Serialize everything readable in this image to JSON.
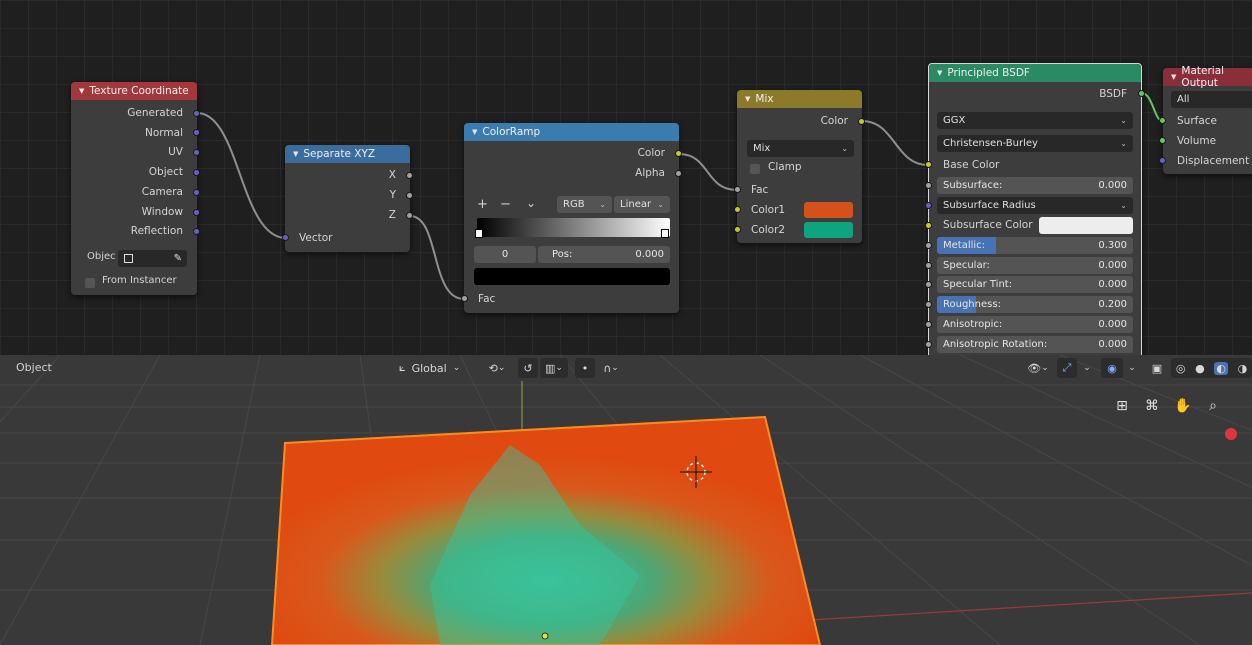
{
  "nodes": {
    "texture_coordinate": {
      "title": "Texture Coordinate",
      "outputs": [
        "Generated",
        "Normal",
        "UV",
        "Object",
        "Camera",
        "Window",
        "Reflection"
      ],
      "object_label": "Objec",
      "from_instancer_label": "From Instancer"
    },
    "separate_xyz": {
      "title": "Separate XYZ",
      "outputs": [
        "X",
        "Y",
        "Z"
      ],
      "input_label": "Vector"
    },
    "color_ramp": {
      "title": "ColorRamp",
      "outputs": [
        "Color",
        "Alpha"
      ],
      "add_symbol": "+",
      "remove_symbol": "−",
      "menu_symbol": "⌄",
      "color_mode": "RGB",
      "interpolation": "Linear",
      "stop_index": "0",
      "pos_label": "Pos:",
      "pos_value": "0.000",
      "input_label": "Fac"
    },
    "mix": {
      "title": "Mix",
      "output_label": "Color",
      "blend_mode": "Mix",
      "clamp_label": "Clamp",
      "fac_label": "Fac",
      "color1_label": "Color1",
      "color2_label": "Color2",
      "color1": "#d4511c",
      "color2": "#0ea57e"
    },
    "principled_bsdf": {
      "title": "Principled BSDF",
      "output_label": "BSDF",
      "distribution": "GGX",
      "subsurface_method": "Christensen-Burley",
      "base_color_label": "Base Color",
      "subsurface_label": "Subsurface:",
      "subsurface_value": "0.000",
      "subsurface_radius_label": "Subsurface Radius",
      "subsurface_color_label": "Subsurface Color",
      "metallic_label": "Metallic:",
      "metallic_value": "0.300",
      "specular_label": "Specular:",
      "specular_value": "0.000",
      "specular_tint_label": "Specular Tint:",
      "specular_tint_value": "0.000",
      "roughness_label": "Roughness:",
      "roughness_value": "0.200",
      "anisotropic_label": "Anisotropic:",
      "anisotropic_value": "0.000",
      "anisotropic_rotation_label": "Anisotropic Rotation:",
      "anisotropic_rotation_value": "0.000"
    },
    "material_output": {
      "title": "Material Output",
      "target": "All",
      "inputs": [
        "Surface",
        "Volume",
        "Displacement"
      ]
    }
  },
  "viewport": {
    "mode_label": "Object",
    "transform_orientation": "Global"
  },
  "colors": {
    "texture_header": "#a3383c",
    "vector_header": "#3a6c9e",
    "converter_header": "#3a7cad",
    "color_header": "#8c7a2a",
    "shader_header": "#2a8a62",
    "output_header": "#8a2e3a",
    "selection_outline": "#ff8c1a"
  }
}
